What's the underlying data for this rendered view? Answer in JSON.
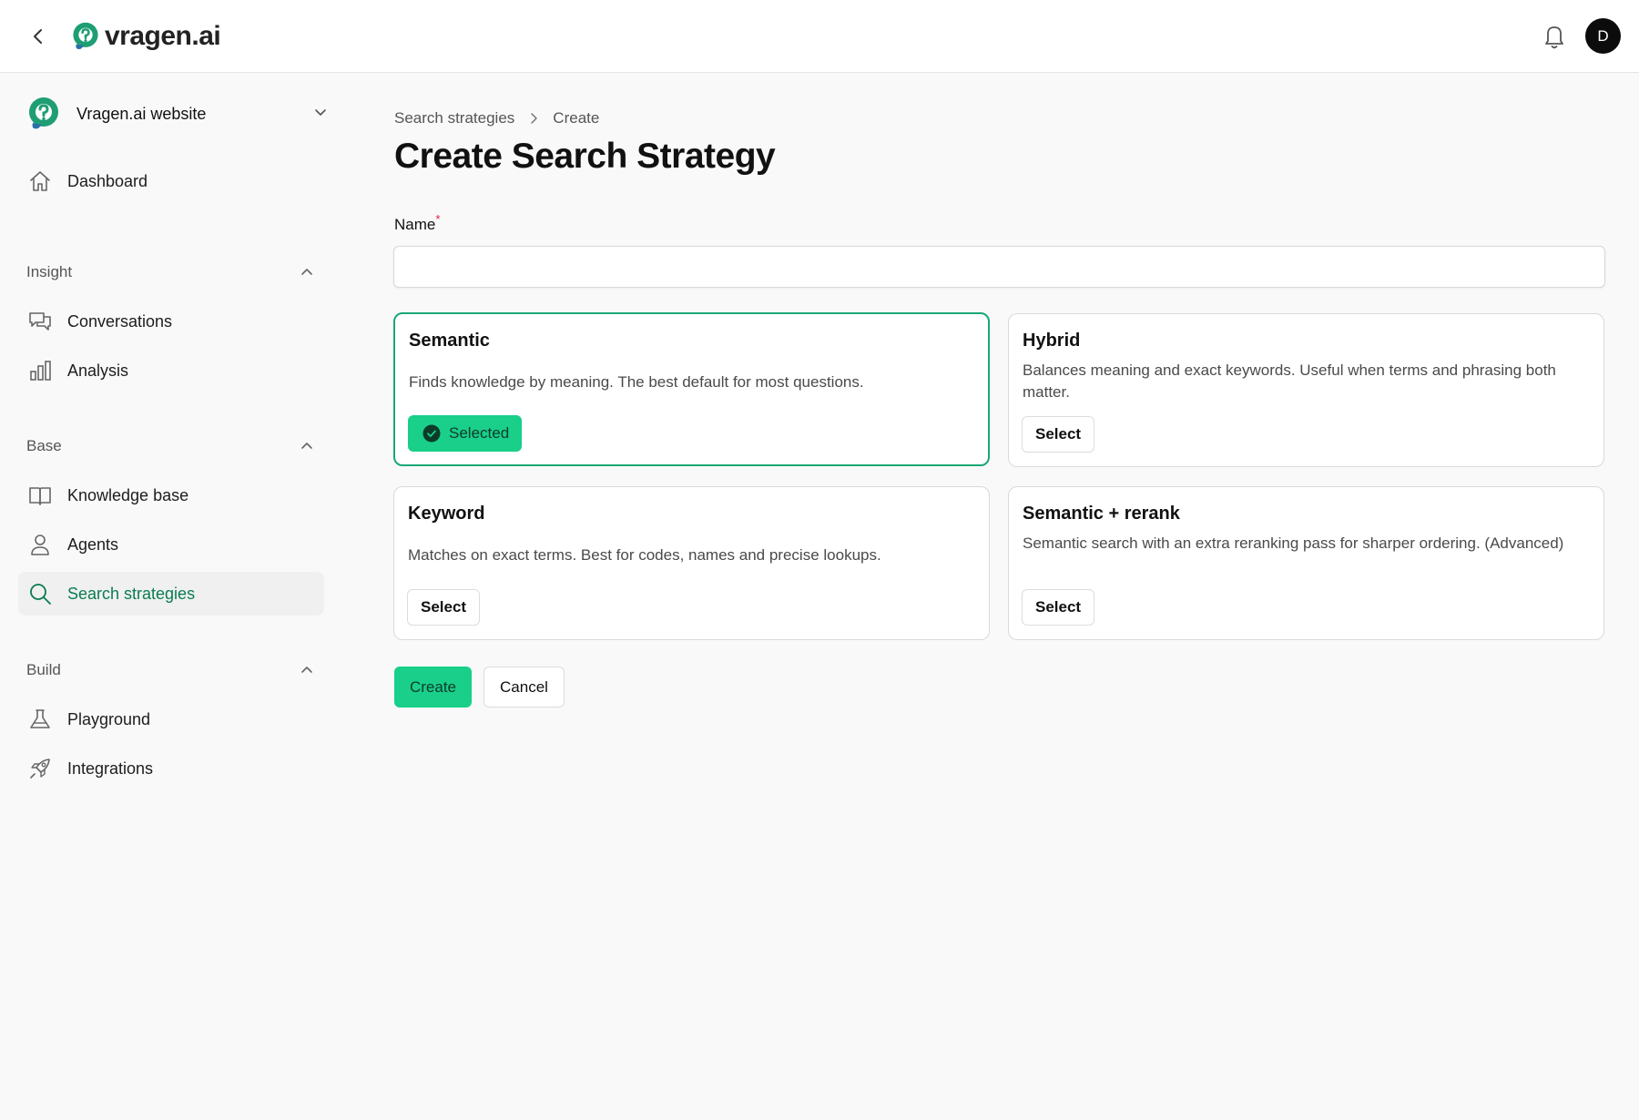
{
  "header": {
    "brand": "vragen.ai",
    "avatar_initial": "D",
    "icons": {
      "back": "chevron-left-icon",
      "notifications": "bell-icon"
    }
  },
  "sidebar": {
    "workspace": "Vragen.ai website",
    "dashboard": "Dashboard",
    "sections": [
      {
        "title": "Insight",
        "items": [
          "Conversations",
          "Analysis"
        ]
      },
      {
        "title": "Base",
        "items": [
          "Knowledge base",
          "Agents",
          "Search strategies"
        ]
      },
      {
        "title": "Build",
        "items": [
          "Playground",
          "Integrations"
        ]
      }
    ],
    "active_item": "Search strategies"
  },
  "breadcrumb": [
    "Search strategies",
    "Create"
  ],
  "page": {
    "title": "Create Search Strategy",
    "name_label": "Name",
    "name_required": "*",
    "name_value": "",
    "name_placeholder": ""
  },
  "strategies": [
    {
      "title": "Semantic",
      "description": "Finds knowledge by meaning. The best default for most questions.",
      "selected": true,
      "button": "Selected"
    },
    {
      "title": "Hybrid",
      "description": "Balances meaning and exact keywords. Useful when terms and phrasing both matter.",
      "selected": false,
      "button": "Select"
    },
    {
      "title": "Keyword",
      "description": "Matches on exact terms. Best for codes, names and precise lookups.",
      "selected": false,
      "button": "Select"
    },
    {
      "title": "Semantic + rerank",
      "description": "Semantic search with an extra reranking pass for sharper ordering. (Advanced)",
      "selected": false,
      "button": "Select"
    }
  ],
  "actions": {
    "create": "Create",
    "cancel": "Cancel"
  },
  "colors": {
    "accent": "#19cf8a",
    "accent_border": "#18a874",
    "active_text": "#0a7c52",
    "required": "#e11d48"
  }
}
